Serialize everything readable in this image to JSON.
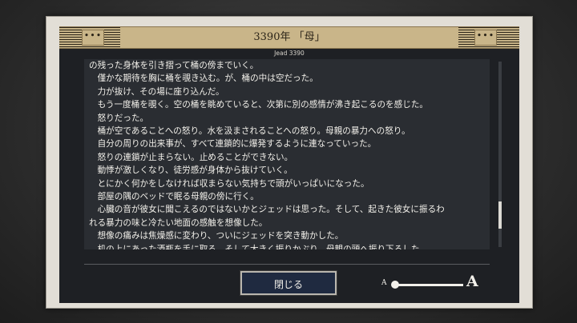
{
  "header": {
    "title": "3390年 「母」",
    "dots_left": "•••",
    "dots_right": "•••"
  },
  "subtitle": "Jead 3390",
  "story_lines": [
    "の残った身体を引き摺って桶の傍までいく。",
    "　僅かな期待を胸に桶を覗き込む。が、桶の中は空だった。",
    "　力が抜け、その場に座り込んだ。",
    "　もう一度桶を覗く。空の桶を眺めていると、次第に別の感情が沸き起こるのを感じた。",
    "　怒りだった。",
    "　桶が空であることへの怒り。水を汲まされることへの怒り。母親の暴力への怒り。",
    "　自分の周りの出来事が、すべて連鎖的に爆発するように連なっていった。",
    "　怒りの連鎖が止まらない。止めることができない。",
    "　動悸が激しくなり、徒労感が身体から抜けていく。",
    "　とにかく何かをしなければ収まらない気持ちで頭がいっぱいになった。",
    "　部屋の隅のベッドで眠る母親の傍に行く。",
    "　心臓の音が彼女に聞こえるのではないかとジェッドは思った。そして、起きた彼女に振るわ",
    "れる暴力の味と冷たい地面の感触を想像した。",
    "　想像の痛みは焦燥感に変わり、ついにジェッドを突き動かした。",
    "　机の上にあった酒瓶を手に取る。そして大きく振りかぶり、母親の頭へ振り下ろした。"
  ],
  "close_button": "閉じる",
  "font_size": {
    "small_label": "A",
    "large_label": "A",
    "level": 0
  }
}
